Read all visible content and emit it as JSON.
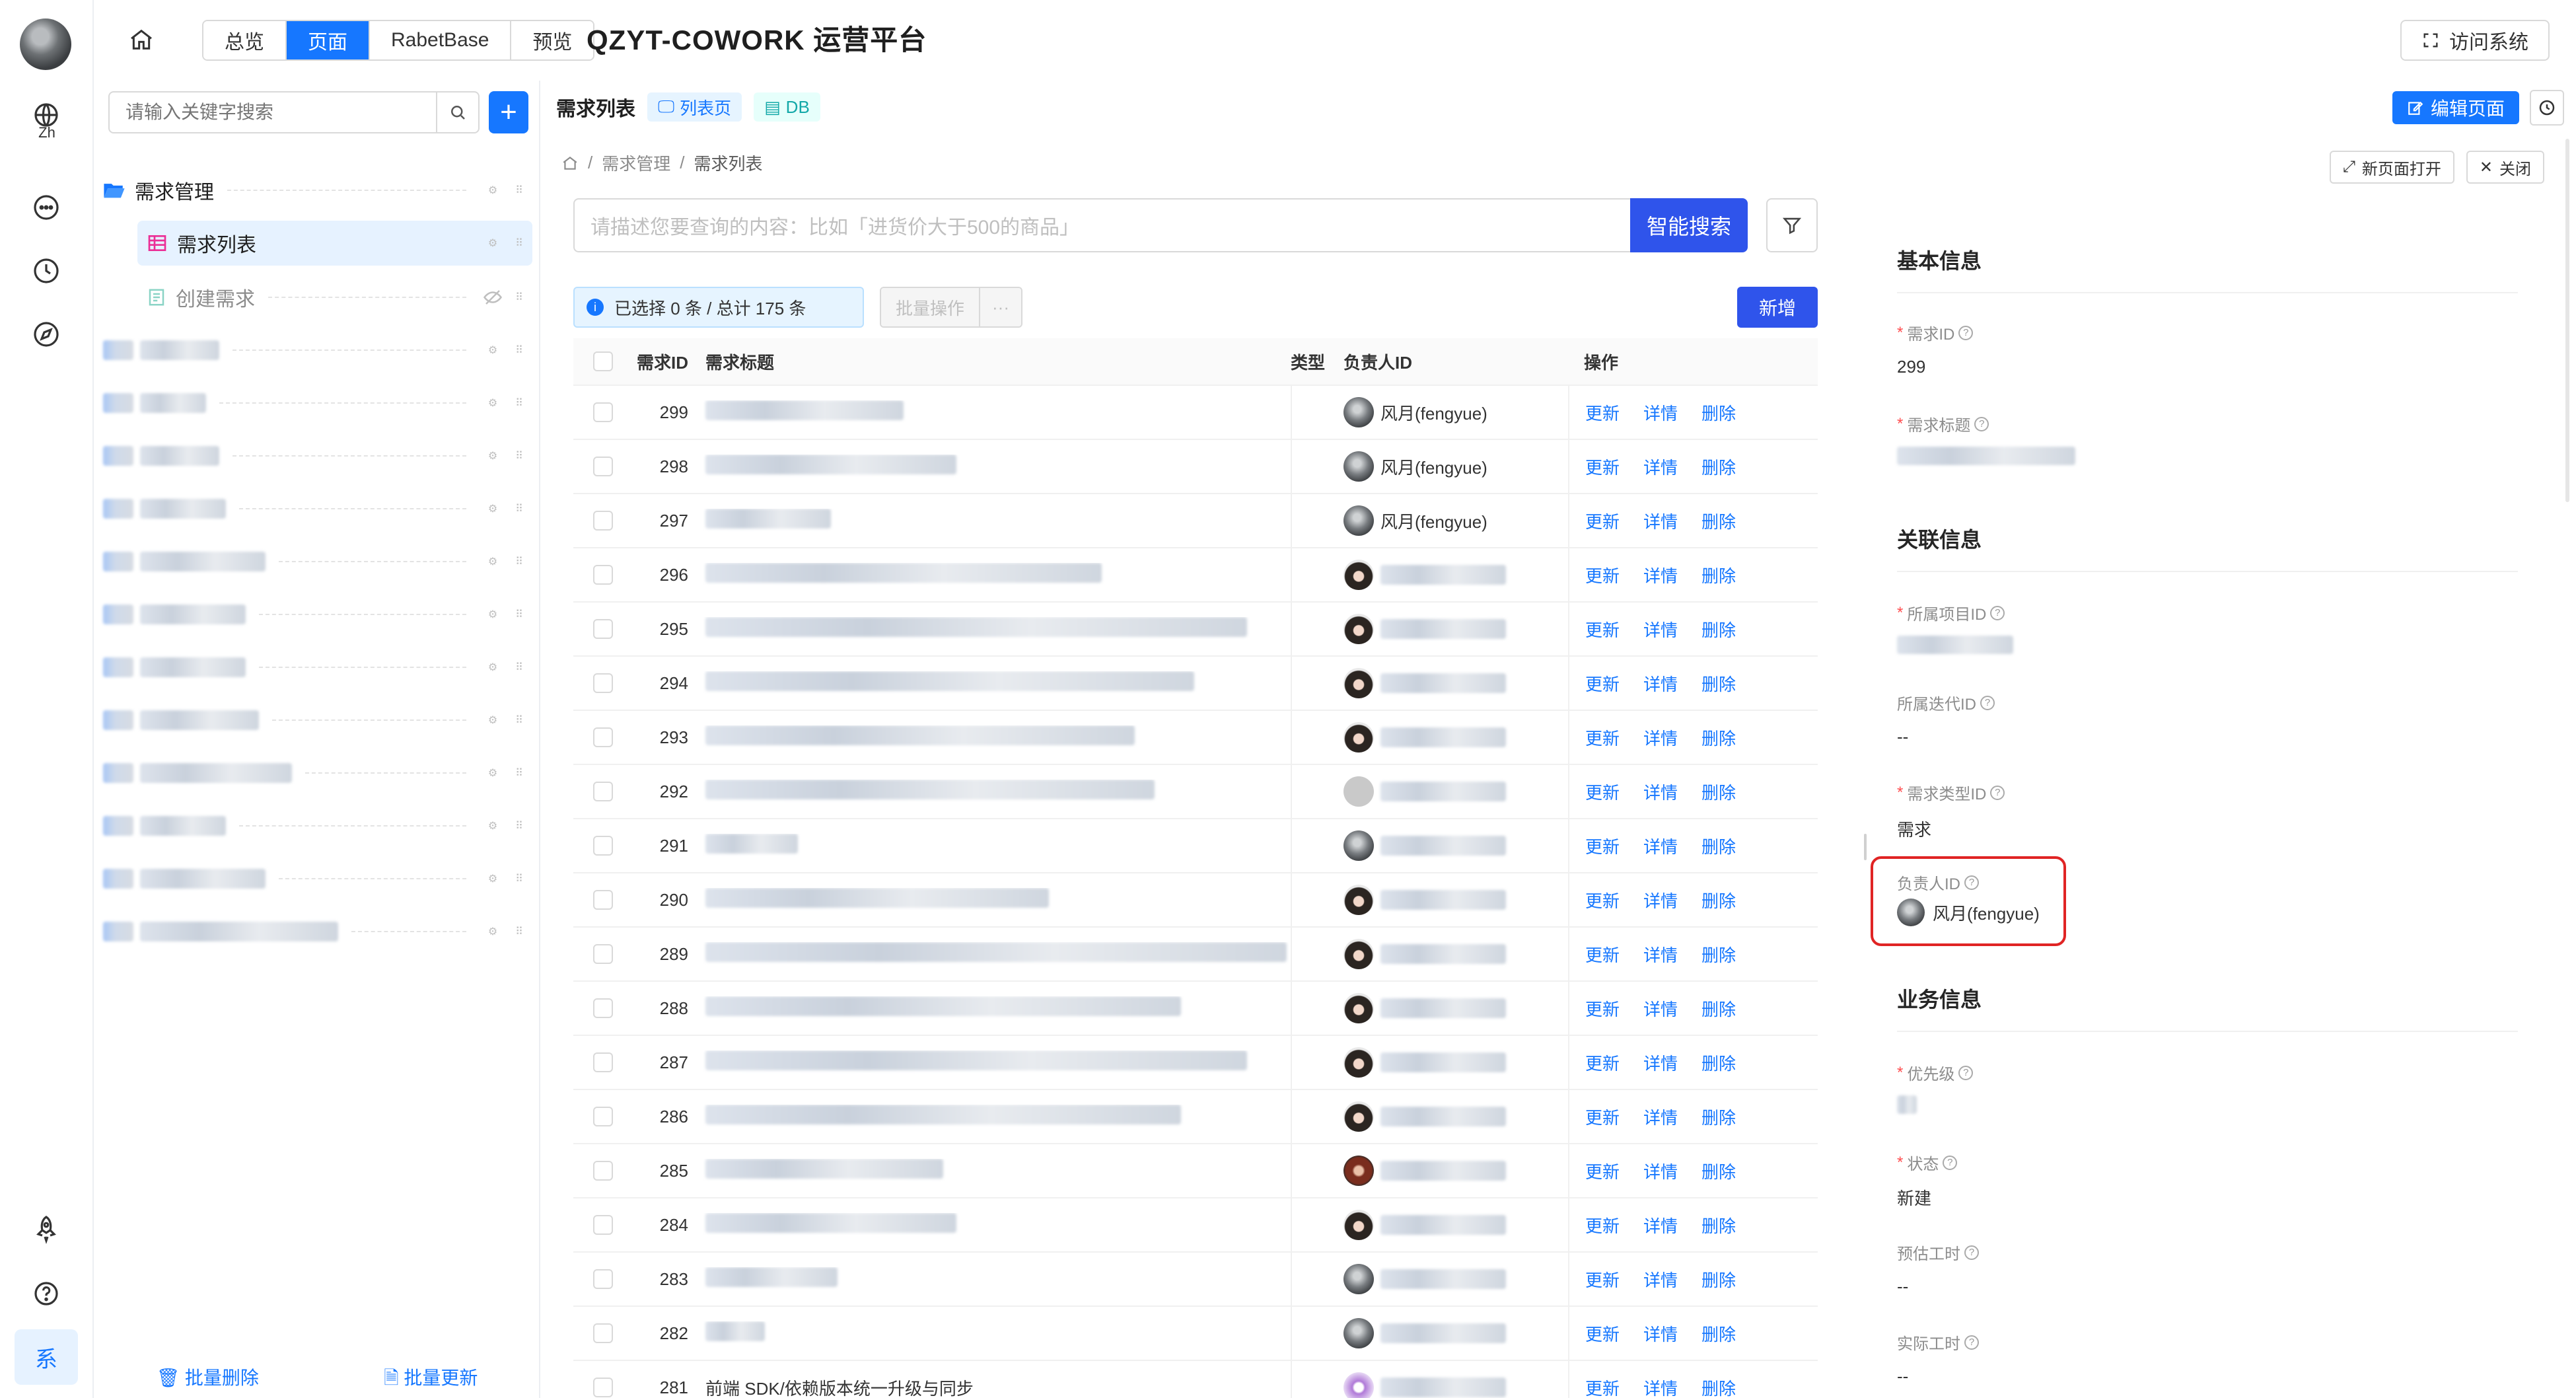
{
  "rail": {
    "lang_label": "Zh",
    "active_label": "系"
  },
  "header": {
    "nav_tabs": [
      "总览",
      "页面",
      "RabetBase",
      "预览"
    ],
    "active_tab": "页面",
    "app_title": "QZYT-COWORK 运营平台",
    "visit_label": "访问系统"
  },
  "sidebar": {
    "search_placeholder": "请输入关键字搜索",
    "group_label": "需求管理",
    "items": [
      {
        "label": "需求列表",
        "selected": true
      },
      {
        "label": "创建需求",
        "hidden": true
      }
    ],
    "footer_delete": "批量删除",
    "footer_update": "批量更新"
  },
  "page": {
    "title": "需求列表",
    "tag_list": "列表页",
    "tag_db": "DB",
    "breadcrumb": [
      "需求管理",
      "需求列表"
    ],
    "query_placeholder": "请描述您要查询的内容：比如「进货价大于500的商品」",
    "smart_search": "智能搜索",
    "selection_info": "已选择 0 条 / 总计 175 条",
    "batch_label": "批量操作",
    "batch_more": "···",
    "add_label": "新增"
  },
  "table": {
    "columns": [
      "需求ID",
      "需求标题",
      "类型",
      "负责人ID",
      "操作"
    ],
    "ops": [
      "更新",
      "详情",
      "删除"
    ],
    "rows": [
      {
        "id": "299",
        "title": "",
        "owner": "风月(fengyue)",
        "avatar": "grey"
      },
      {
        "id": "298",
        "title": "",
        "owner": "风月(fengyue)",
        "avatar": "grey"
      },
      {
        "id": "297",
        "title": "",
        "owner": "风月(fengyue)",
        "avatar": "grey"
      },
      {
        "id": "296",
        "title": "",
        "owner": "",
        "avatar": "girl"
      },
      {
        "id": "295",
        "title": "",
        "owner": "",
        "avatar": "girl"
      },
      {
        "id": "294",
        "title": "",
        "owner": "",
        "avatar": "girl"
      },
      {
        "id": "293",
        "title": "",
        "owner": "",
        "avatar": "girl"
      },
      {
        "id": "292",
        "title": "",
        "owner": "",
        "avatar": "light"
      },
      {
        "id": "291",
        "title": "",
        "owner": "",
        "avatar": "grey"
      },
      {
        "id": "290",
        "title": "",
        "owner": "",
        "avatar": "girl"
      },
      {
        "id": "289",
        "title": "",
        "owner": "",
        "avatar": "girl"
      },
      {
        "id": "288",
        "title": "",
        "owner": "",
        "avatar": "girl"
      },
      {
        "id": "287",
        "title": "",
        "owner": "",
        "avatar": "girl"
      },
      {
        "id": "286",
        "title": "",
        "owner": "",
        "avatar": "girl"
      },
      {
        "id": "285",
        "title": "",
        "owner": "",
        "avatar": "red"
      },
      {
        "id": "284",
        "title": "",
        "owner": "",
        "avatar": "girl"
      },
      {
        "id": "283",
        "title": "",
        "owner": "",
        "avatar": "grey"
      },
      {
        "id": "282",
        "title": "",
        "owner": "",
        "avatar": "grey"
      },
      {
        "id": "281",
        "title": "前端 SDK/依赖版本统一升级与同步",
        "owner": "",
        "avatar": "pur"
      }
    ]
  },
  "drawer": {
    "edit_page": "编辑页面",
    "open_new": "新页面打开",
    "close": "关闭",
    "sections": {
      "basic": "基本信息",
      "related": "关联信息",
      "business": "业务信息"
    },
    "fields": {
      "req_id_label": "需求ID",
      "req_id_value": "299",
      "req_title_label": "需求标题",
      "project_label": "所属项目ID",
      "iteration_label": "所属迭代ID",
      "iteration_value": "--",
      "type_label": "需求类型ID",
      "type_value": "需求",
      "owner_label": "负责人ID",
      "owner_value": "风月(fengyue)",
      "priority_label": "优先级",
      "status_label": "状态",
      "status_value": "新建",
      "est_label": "预估工时",
      "est_value": "--",
      "actual_label": "实际工时",
      "actual_value": "--"
    }
  },
  "colors": {
    "primary": "#1677ff",
    "search_button": "#2f54eb",
    "highlight_box": "#e02424"
  }
}
